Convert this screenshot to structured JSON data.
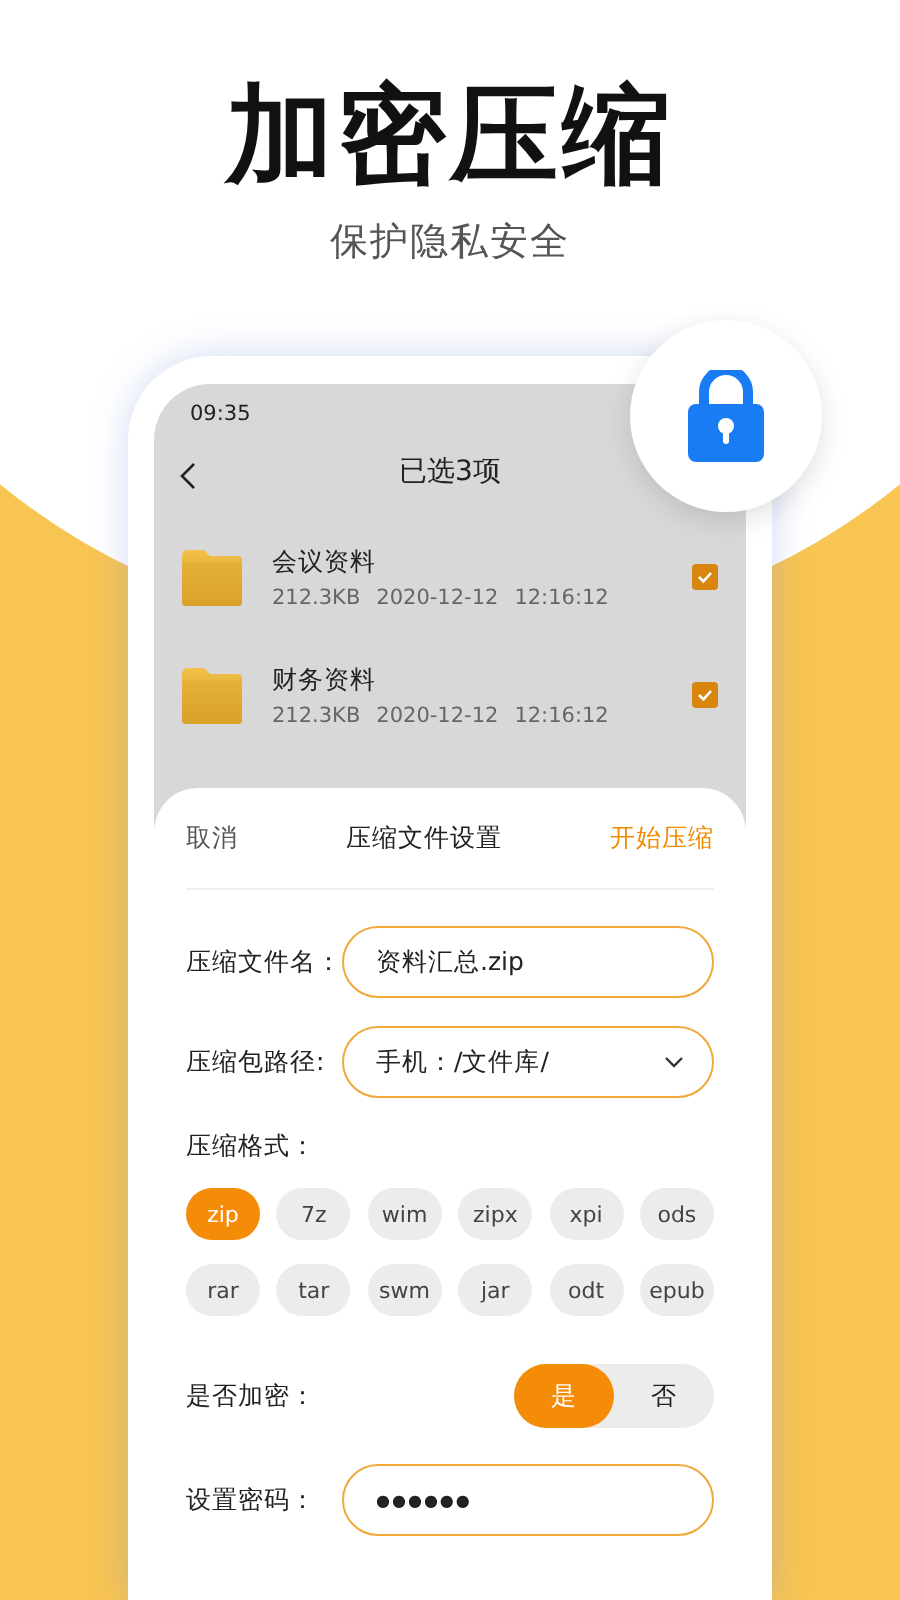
{
  "headline": "加密压缩",
  "subtitle": "保护隐私安全",
  "status_bar": {
    "time": "09:35"
  },
  "header": {
    "title": "已选3项"
  },
  "files": [
    {
      "name": "会议资料",
      "size": "212.3KB",
      "date": "2020-12-12",
      "time": "12:16:12",
      "checked": true
    },
    {
      "name": "财务资料",
      "size": "212.3KB",
      "date": "2020-12-12",
      "time": "12:16:12",
      "checked": true
    }
  ],
  "sheet": {
    "cancel": "取消",
    "title": "压缩文件设置",
    "confirm": "开始压缩",
    "fields": [
      {
        "kind": "text",
        "label": "压缩文件名：",
        "value": "资料汇总.zip"
      },
      {
        "kind": "dropdown",
        "label": "压缩包路径:",
        "value": "手机：/文件库/"
      }
    ],
    "format_label": "压缩格式：",
    "formats": [
      {
        "label": "zip",
        "selected": true
      },
      {
        "label": "7z",
        "selected": false
      },
      {
        "label": "wim",
        "selected": false
      },
      {
        "label": "zipx",
        "selected": false
      },
      {
        "label": "xpi",
        "selected": false
      },
      {
        "label": "ods",
        "selected": false
      },
      {
        "label": "rar",
        "selected": false
      },
      {
        "label": "tar",
        "selected": false
      },
      {
        "label": "swm",
        "selected": false
      },
      {
        "label": "jar",
        "selected": false
      },
      {
        "label": "odt",
        "selected": false
      },
      {
        "label": "epub",
        "selected": false
      }
    ],
    "encrypt": {
      "label": "是否加密：",
      "options": [
        {
          "label": "是",
          "selected": true
        },
        {
          "label": "否",
          "selected": false
        }
      ]
    },
    "password": {
      "label": "设置密码：",
      "value": "●●●●●●"
    }
  }
}
